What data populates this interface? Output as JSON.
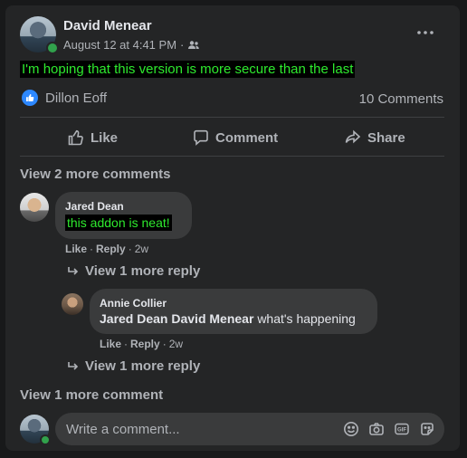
{
  "post": {
    "author": "David Menear",
    "date": "August 12 at 4:41 PM",
    "separator": "·",
    "text": "I'm hoping that this version is more secure than the last",
    "reaction_name": "Dillon Eoff",
    "comments_count": "10 Comments"
  },
  "actions": {
    "like": "Like",
    "comment": "Comment",
    "share": "Share"
  },
  "comments": {
    "view_more_top": "View 2 more comments",
    "c1": {
      "author": "Jared Dean",
      "text": "this addon is neat!",
      "like": "Like",
      "dot": "·",
      "reply": "Reply",
      "time": "2w",
      "view_replies": "View 1 more reply"
    },
    "c2": {
      "author": "Annie Collier",
      "mention1": "Jared Dean",
      "mention2": "David Menear",
      "text": "what's happening",
      "like": "Like",
      "dot": "·",
      "reply": "Reply",
      "time": "2w",
      "view_replies": "View 1 more reply"
    },
    "view_more_bottom": "View 1 more comment"
  },
  "composer": {
    "placeholder": "Write a comment..."
  },
  "icons": {
    "more": "more-icon",
    "audience": "friends-icon",
    "like_reaction": "like-reaction-icon",
    "emoji": "emoji-icon",
    "camera": "camera-icon",
    "gif": "gif-icon",
    "sticker": "sticker-icon"
  },
  "colors": {
    "background": "#18191a",
    "card": "#242526",
    "bubble": "#3a3b3c",
    "text_primary": "#e4e6eb",
    "text_secondary": "#b0b3b8",
    "accent_blue": "#2d88ff",
    "highlight_text": "#2eea2e",
    "highlight_bg": "#000000"
  }
}
